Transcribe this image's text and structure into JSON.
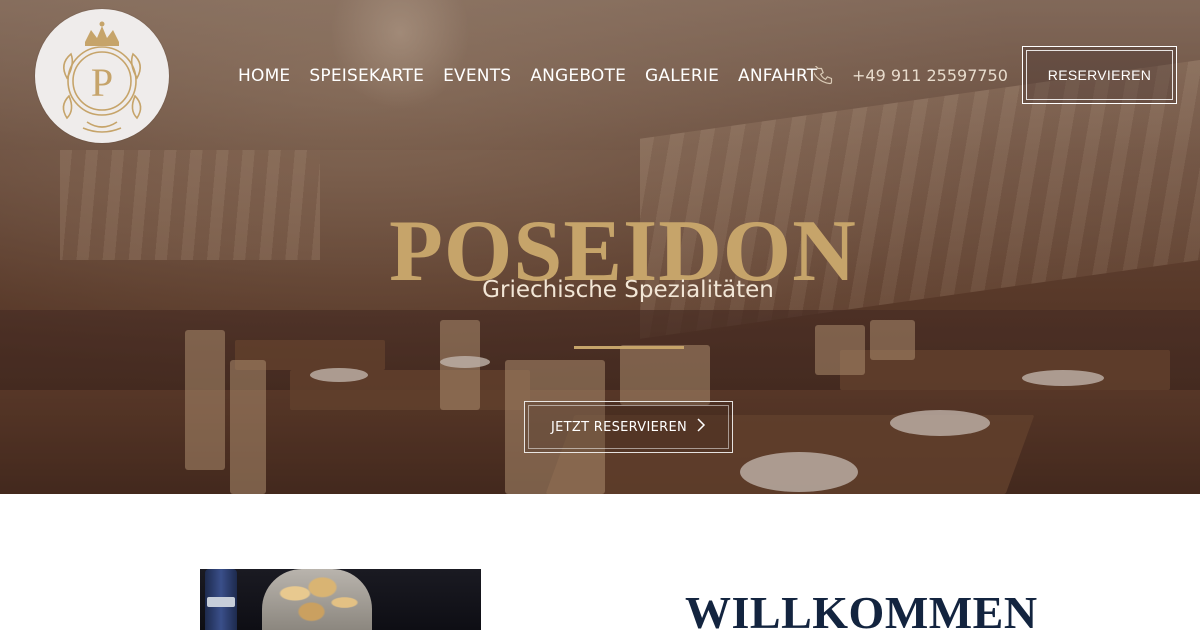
{
  "brand": {
    "logo_letter": "P"
  },
  "nav": {
    "items": [
      {
        "label": "HOME"
      },
      {
        "label": "SPEISEKARTE"
      },
      {
        "label": "EVENTS"
      },
      {
        "label": "ANGEBOTE"
      },
      {
        "label": "GALERIE"
      },
      {
        "label": "ANFAHRT"
      }
    ]
  },
  "contact": {
    "phone": "+49 911 25597750",
    "icon": "phone-icon"
  },
  "header": {
    "reserve_label": "RESERVIEREN"
  },
  "hero": {
    "title": "POSEIDON",
    "subtitle": "Griechische Spezialitäten",
    "cta_label": "JETZT RESERVIEREN",
    "cta_icon": "chevron-right-icon"
  },
  "welcome": {
    "heading": "WILLKOMMEN"
  },
  "colors": {
    "gold": "#c6a46a",
    "navy": "#13243f",
    "white": "#ffffff"
  }
}
